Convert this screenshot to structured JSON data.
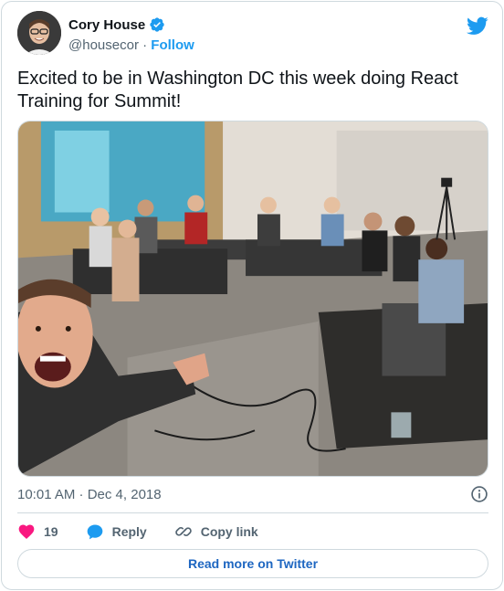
{
  "author": {
    "display_name": "Cory House",
    "handle": "@housecor",
    "separator": "·",
    "follow_label": "Follow",
    "verified": true
  },
  "tweet": {
    "text": "Excited to be in Washington DC this week doing React Training for Summit!",
    "timestamp": "10:01 AM · Dec 4, 2018"
  },
  "actions": {
    "like_count": "19",
    "reply_label": "Reply",
    "copy_link_label": "Copy link"
  },
  "read_more_label": "Read more on Twitter",
  "colors": {
    "twitter_blue": "#1d9bf0",
    "like_red": "#f91880",
    "read_more_blue": "#1d66c1",
    "muted_text": "#536471",
    "border": "#cfd9de"
  },
  "icons": {
    "brand": "twitter-bird-icon",
    "verified": "verified-badge-icon",
    "info": "info-icon",
    "like": "heart-icon",
    "reply": "chat-bubble-icon",
    "copy_link": "link-icon"
  }
}
